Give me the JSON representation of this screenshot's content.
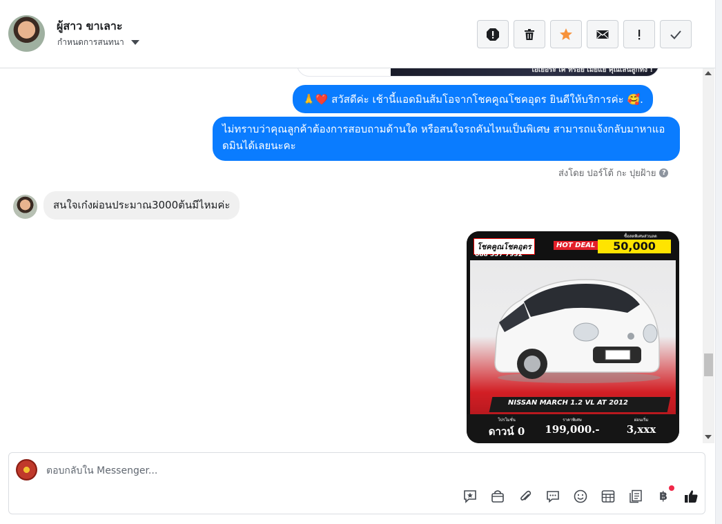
{
  "header": {
    "name": "ผู้สาว ขาเลาะ",
    "subtitle": "กำหนดการสนทนา",
    "actions": [
      {
        "name": "report-icon",
        "label": "!"
      },
      {
        "name": "trash-icon",
        "label": ""
      },
      {
        "name": "star-icon",
        "label": ""
      },
      {
        "name": "envelope-icon",
        "label": ""
      },
      {
        "name": "exclamation-icon",
        "label": "!"
      },
      {
        "name": "check-icon",
        "label": ""
      }
    ],
    "star_color": "#f7923b"
  },
  "messages": {
    "prev_card_text": "ไอเยือระ เค ทรอย เมย์แย คุณเลนลูกทั้ง !",
    "out_1": "🙏❤️ สวัสดีค่ะ เช้านี้แอดมินส้มโอจากโชคคูณโชคอุดร ยินดีให้บริการค่ะ 🥰.",
    "out_2": "ไม่ทราบว่าคุณลูกค้าต้องการสอบถามด้านใด หรือสนใจรถคันไหนเป็นพิเศษ สามารถแจ้งกลับมาหาแอดมินได้เลยนะคะ",
    "sent_by": "ส่งโดย ปอร์โต้ กะ ปุยฝ้าย",
    "in_1": "สนใจเก๋งผ่อนประมาณ3000ต้นมีไหมค่ะ",
    "bubble_color": "#0a7cff"
  },
  "car_ad": {
    "logo": "โชคคูณโชคอุดร",
    "phone": "088 557 7932",
    "hot_deal": "HOT DEAL",
    "top_price": "50,000",
    "top_note": "ซื้อสดพิเศษส่วนลด",
    "model": "NISSAN MARCH 1.2 VL AT 2012",
    "down_label": "โปรโมชั่น",
    "down_value": "ดาวน์ 0",
    "price_label": "ราคาพิเศษ",
    "price_value": "199,000.-",
    "installment_label": "ผ่อนเริ่ม",
    "installment_value": "3,xxx"
  },
  "composer": {
    "placeholder": "ตอบกลับใน Messenger...",
    "tools": [
      "saved-reply-icon",
      "shop-bag-icon",
      "attachment-icon",
      "chat-bubbles-icon",
      "emoji-icon",
      "table-icon",
      "notes-icon",
      "baht-icon",
      "thumbs-up-icon"
    ],
    "baht_symbol": "฿"
  }
}
